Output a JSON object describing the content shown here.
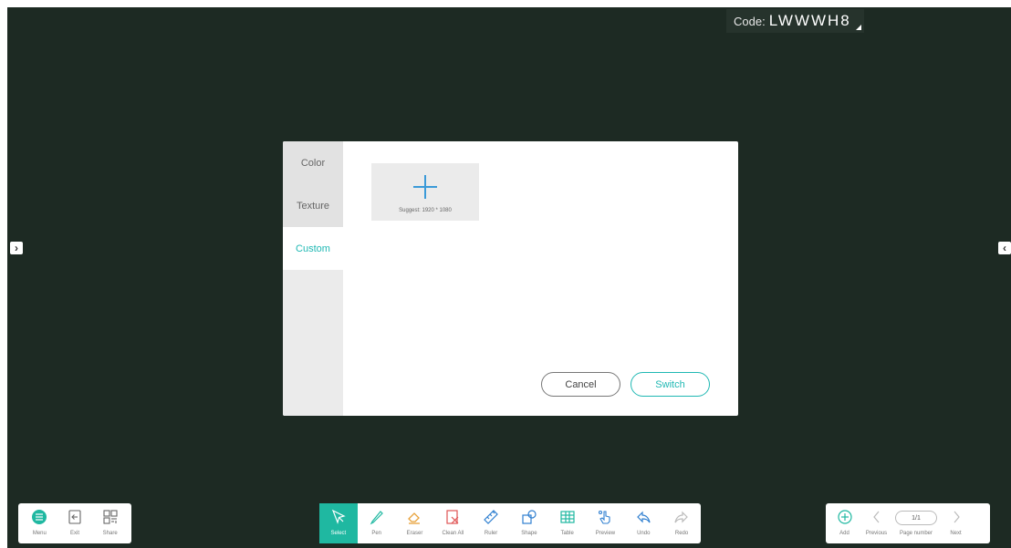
{
  "code": {
    "label": "Code:",
    "value": "LWWWH8"
  },
  "dialog": {
    "tabs": [
      {
        "label": "Color",
        "active": false
      },
      {
        "label": "Texture",
        "active": false
      },
      {
        "label": "Custom",
        "active": true
      }
    ],
    "upload_hint": "Suggest: 1920 * 1080",
    "cancel_label": "Cancel",
    "switch_label": "Switch"
  },
  "toolbar_left": [
    {
      "label": "Menu",
      "icon": "menu-icon"
    },
    {
      "label": "Exit",
      "icon": "exit-icon"
    },
    {
      "label": "Share",
      "icon": "qr-code-icon"
    }
  ],
  "toolbar_mid": [
    {
      "label": "Select",
      "icon": "cursor-icon",
      "active": true
    },
    {
      "label": "Pen",
      "icon": "pen-icon"
    },
    {
      "label": "Eraser",
      "icon": "eraser-icon"
    },
    {
      "label": "Clean All",
      "icon": "clean-all-icon"
    },
    {
      "label": "Ruler",
      "icon": "ruler-icon"
    },
    {
      "label": "Shape",
      "icon": "shape-icon"
    },
    {
      "label": "Table",
      "icon": "table-icon"
    },
    {
      "label": "Preview",
      "icon": "preview-hand-icon"
    },
    {
      "label": "Undo",
      "icon": "undo-icon"
    },
    {
      "label": "Redo",
      "icon": "redo-icon"
    }
  ],
  "toolbar_right": {
    "add_label": "Add",
    "previous_label": "Previous",
    "page_value": "1/1",
    "page_number_label": "Page number",
    "next_label": "Next"
  },
  "colors": {
    "board": "#1d2a23",
    "accent": "#1fb8b3",
    "select_active": "#1fb8a1"
  }
}
